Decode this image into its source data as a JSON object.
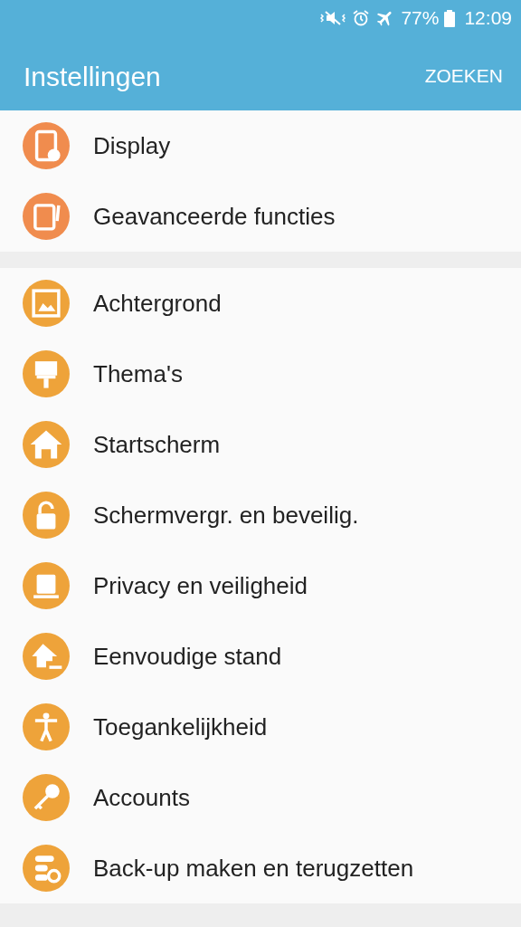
{
  "status_bar": {
    "battery": "77%",
    "time": "12:09"
  },
  "toolbar": {
    "title": "Instellingen",
    "action": "ZOEKEN"
  },
  "sections": [
    {
      "items": [
        {
          "label": "Display",
          "color": "#f08c4e"
        },
        {
          "label": "Geavanceerde functies",
          "color": "#f08c4e"
        }
      ]
    },
    {
      "items": [
        {
          "label": "Achtergrond",
          "color": "#eea33a"
        },
        {
          "label": "Thema's",
          "color": "#eea33a"
        },
        {
          "label": "Startscherm",
          "color": "#eea33a"
        },
        {
          "label": "Schermvergr. en beveilig.",
          "color": "#eea33a"
        },
        {
          "label": "Privacy en veiligheid",
          "color": "#eea33a"
        },
        {
          "label": "Eenvoudige stand",
          "color": "#eea33a"
        },
        {
          "label": "Toegankelijkheid",
          "color": "#eea33a"
        },
        {
          "label": "Accounts",
          "color": "#eea33a"
        },
        {
          "label": "Back-up maken en terugzetten",
          "color": "#eea33a"
        }
      ]
    }
  ]
}
